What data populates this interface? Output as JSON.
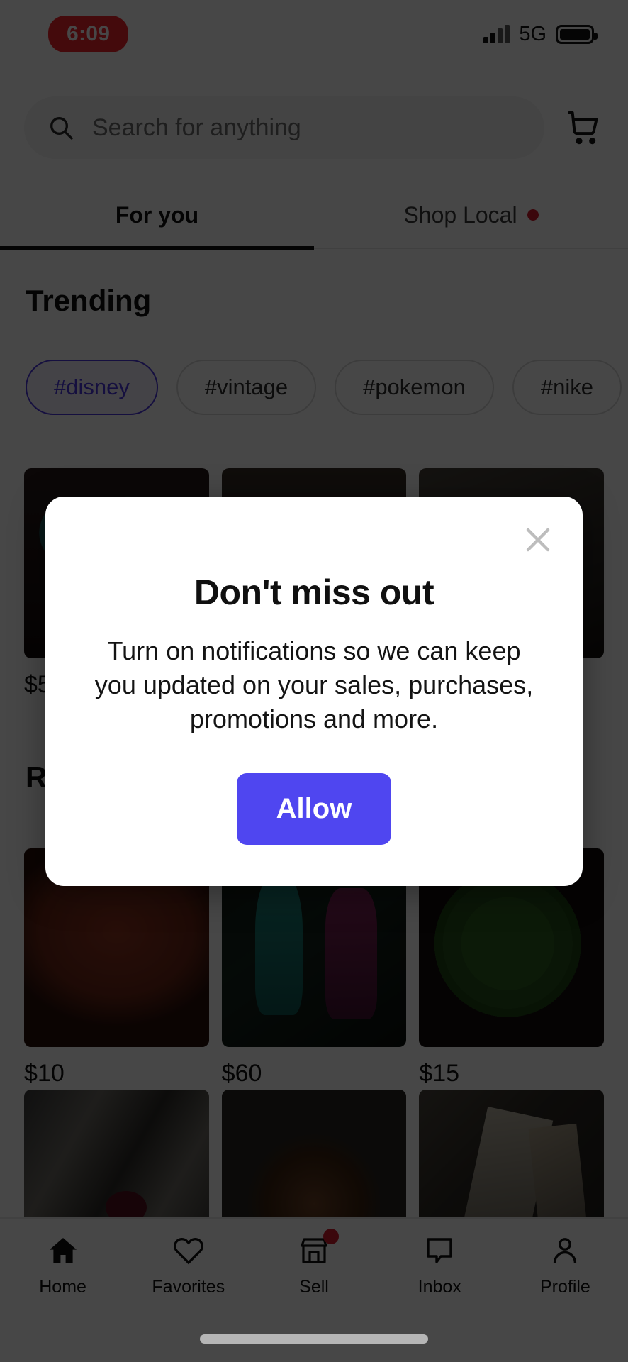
{
  "status_bar": {
    "recording_time": "6:09",
    "network": "5G",
    "signal_icon": "signal-bars-icon",
    "battery_icon": "battery-icon"
  },
  "header": {
    "search": {
      "placeholder": "Search for anything",
      "value": "",
      "icon": "search-icon"
    },
    "cart_icon": "shopping-cart-icon"
  },
  "tabs": [
    {
      "label": "For you",
      "active": true,
      "badge": false
    },
    {
      "label": "Shop Local",
      "active": false,
      "badge": true
    }
  ],
  "trending": {
    "title": "Trending",
    "chips": [
      {
        "label": "#disney",
        "selected": true
      },
      {
        "label": "#vintage",
        "selected": false
      },
      {
        "label": "#pokemon",
        "selected": false
      },
      {
        "label": "#nike",
        "selected": false
      }
    ]
  },
  "sections": {
    "recent_title": "R"
  },
  "grid": {
    "row1": [
      {
        "price": "$5",
        "photo": "p-glasses"
      },
      {
        "price": "",
        "photo": "p-shelf"
      },
      {
        "price": "$",
        "photo": "p-room"
      }
    ],
    "row2": [
      {
        "price": "$10",
        "photo": "p-crochet"
      },
      {
        "price": "$60",
        "photo": "p-dress"
      },
      {
        "price": "$15",
        "photo": "p-plate"
      }
    ],
    "row3": [
      {
        "price": "",
        "photo": "p-jewel"
      },
      {
        "price": "",
        "photo": "p-dog"
      },
      {
        "price": "",
        "photo": "p-paper"
      }
    ]
  },
  "bottom_nav": [
    {
      "label": "Home",
      "icon": "home-icon",
      "active": true,
      "badge": false
    },
    {
      "label": "Favorites",
      "icon": "heart-icon",
      "active": false,
      "badge": false
    },
    {
      "label": "Sell",
      "icon": "storefront-icon",
      "active": false,
      "badge": true
    },
    {
      "label": "Inbox",
      "icon": "chat-bubble-icon",
      "active": false,
      "badge": false
    },
    {
      "label": "Profile",
      "icon": "person-icon",
      "active": false,
      "badge": false
    }
  ],
  "modal": {
    "title": "Don't miss out",
    "body": "Turn on notifications so we can keep you updated on your sales, purchases, promotions and more.",
    "allow_label": "Allow",
    "close_icon": "close-icon"
  },
  "colors": {
    "accent_purple": "#4f46f0",
    "chip_selected": "#4b36e0",
    "badge_red": "#d31c2e",
    "recording_red": "#f5272c"
  }
}
